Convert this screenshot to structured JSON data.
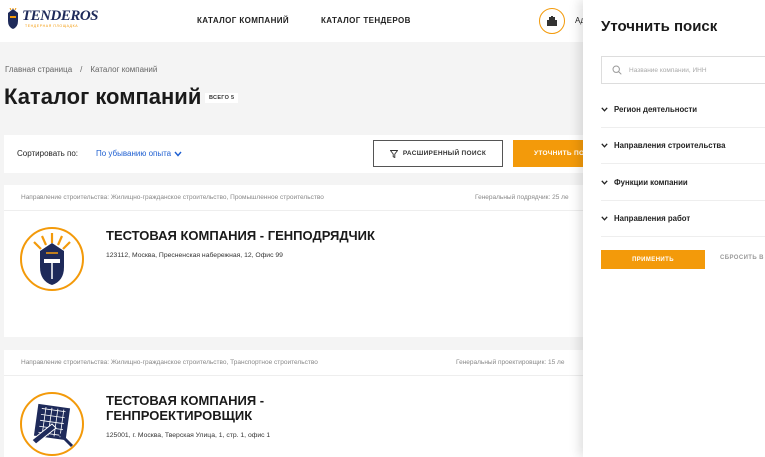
{
  "header": {
    "logo_word": "TENDEROS",
    "logo_sub": "ТЕНДЕРНАЯ ПЛОЩАДКА",
    "nav": [
      "КАТАЛОГ КОМПАНИЙ",
      "КАТАЛОГ ТЕНДЕРОВ"
    ],
    "user_label": "Ад"
  },
  "breadcrumb": {
    "home": "Главная страница",
    "separator": "/",
    "current": "Каталог компаний"
  },
  "page": {
    "title": "Каталог компаний",
    "total_badge": "ВСЕГО 5"
  },
  "sort": {
    "label": "Сортировать по:",
    "value": "По убыванию опыта",
    "advanced_search": "РАСШИРЕННЫЙ ПОИСК",
    "refine": "УТОЧНИТЬ ПО"
  },
  "companies": [
    {
      "direction": "Направление строительства: Жилищно-гражданское строительство, Промышленное строительство",
      "role": "Генеральный подрядчик: 25 ле",
      "name": "ТЕСТОВАЯ КОМПАНИЯ - ГЕНПОДРЯДЧИК",
      "address": "123112, Москва, Пресненская набережная, 12, Офис 99"
    },
    {
      "direction": "Направление строительства: Жилищно-гражданское строительство, Транспортное строительство",
      "role": "Генеральный проектировщик: 15 ле",
      "name": "ТЕСТОВАЯ КОМПАНИЯ - ГЕНПРОЕКТИРОВЩИК",
      "address": "125001, г. Москва, Тверская Улица, 1, стр. 1, офис 1"
    }
  ],
  "panel": {
    "title": "Уточнить поиск",
    "search_placeholder": "Название компании, ИНН",
    "filters": [
      "Регион деятельности",
      "Направления строительства",
      "Функции компании",
      "Направления работ"
    ],
    "apply": "ПРИМЕНИТЬ",
    "reset": "СБРОСИТЬ В"
  },
  "colors": {
    "accent": "#f39a0a",
    "link": "#1e5fd1",
    "logo_navy": "#1e2a5a"
  }
}
